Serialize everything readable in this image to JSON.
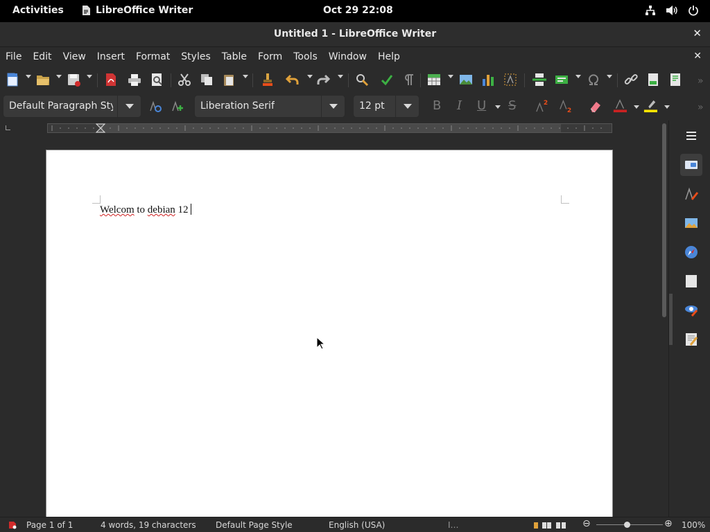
{
  "topbar": {
    "activities": "Activities",
    "app_name": "LibreOffice Writer",
    "clock": "Oct 29  22:08",
    "tray_icons": [
      "network-icon",
      "volume-icon",
      "power-icon"
    ]
  },
  "window": {
    "title": "Untitled 1 - LibreOffice Writer",
    "close": "✕"
  },
  "menu": {
    "items": [
      "File",
      "Edit",
      "View",
      "Insert",
      "Format",
      "Styles",
      "Table",
      "Form",
      "Tools",
      "Window",
      "Help"
    ],
    "close": "✕"
  },
  "formatting": {
    "paragraph_style": "Default Paragraph Style",
    "font_name": "Liberation Serif",
    "font_size": "12 pt",
    "bold": "B",
    "italic": "I",
    "underline": "U",
    "strike": "S"
  },
  "document": {
    "words": [
      "Welcom",
      "to",
      "debian",
      "12"
    ]
  },
  "status": {
    "page": "Page 1 of 1",
    "counts": "4 words, 19 characters",
    "page_style": "Default Page Style",
    "language": "English (USA)",
    "zoom": "100%"
  },
  "colors": {
    "accent_red": "#d02020",
    "font_color": "#cc2222",
    "highlight": "#ffe600"
  }
}
